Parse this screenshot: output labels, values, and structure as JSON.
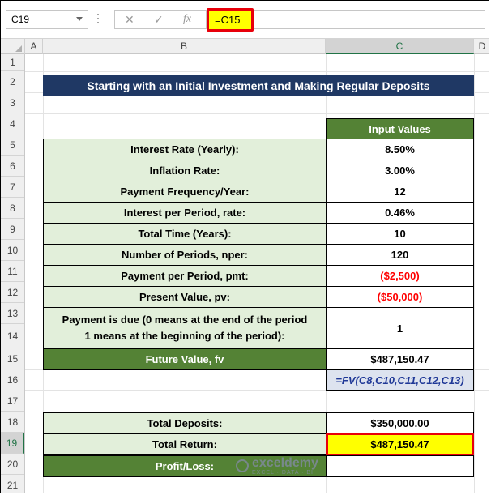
{
  "formula_bar": {
    "name_box": "C19",
    "cancel_icon": "✕",
    "enter_icon": "✓",
    "fx_label": "fx",
    "formula": "=C15"
  },
  "columns": [
    "A",
    "B",
    "C",
    "D"
  ],
  "rows": [
    "1",
    "2",
    "3",
    "4",
    "5",
    "6",
    "7",
    "8",
    "9",
    "10",
    "11",
    "12",
    "13",
    "14",
    "15",
    "16",
    "17",
    "18",
    "19",
    "20",
    "21"
  ],
  "sheet": {
    "title": "Starting with an Initial Investment and Making Regular Deposits",
    "input_header": "Input Values",
    "items": [
      {
        "label": "Interest Rate (Yearly):",
        "value": "8.50%"
      },
      {
        "label": "Inflation Rate:",
        "value": "3.00%"
      },
      {
        "label": "Payment Frequency/Year:",
        "value": "12"
      },
      {
        "label": "Interest per Period, rate:",
        "value": "0.46%"
      },
      {
        "label": "Total Time (Years):",
        "value": "10"
      },
      {
        "label": "Number of Periods, nper:",
        "value": "120"
      },
      {
        "label": "Payment per Period, pmt:",
        "value": "($2,500)"
      },
      {
        "label": "Present Value, pv:",
        "value": "($50,000)"
      }
    ],
    "due_label_line1": "Payment is due (0 means at the end of the period",
    "due_label_line2": "1 means at the beginning of the period):",
    "due_value": "1",
    "fv_label": "Future Value, fv",
    "fv_value": "$487,150.47",
    "fv_formula": "=FV(C8,C10,C11,C12,C13)",
    "total_deposits_label": "Total Deposits:",
    "total_deposits_value": "$350,000.00",
    "total_return_label": "Total Return:",
    "total_return_value": "$487,150.47",
    "profit_label": "Profit/Loss:"
  },
  "watermark": {
    "name": "exceldemy",
    "tagline": "EXCEL · DATA · BI"
  },
  "colors": {
    "title_bg": "#1f3864",
    "label_bg": "#e2efda",
    "dark_green": "#548235",
    "highlight": "#ffff00",
    "red": "#ff0000"
  }
}
